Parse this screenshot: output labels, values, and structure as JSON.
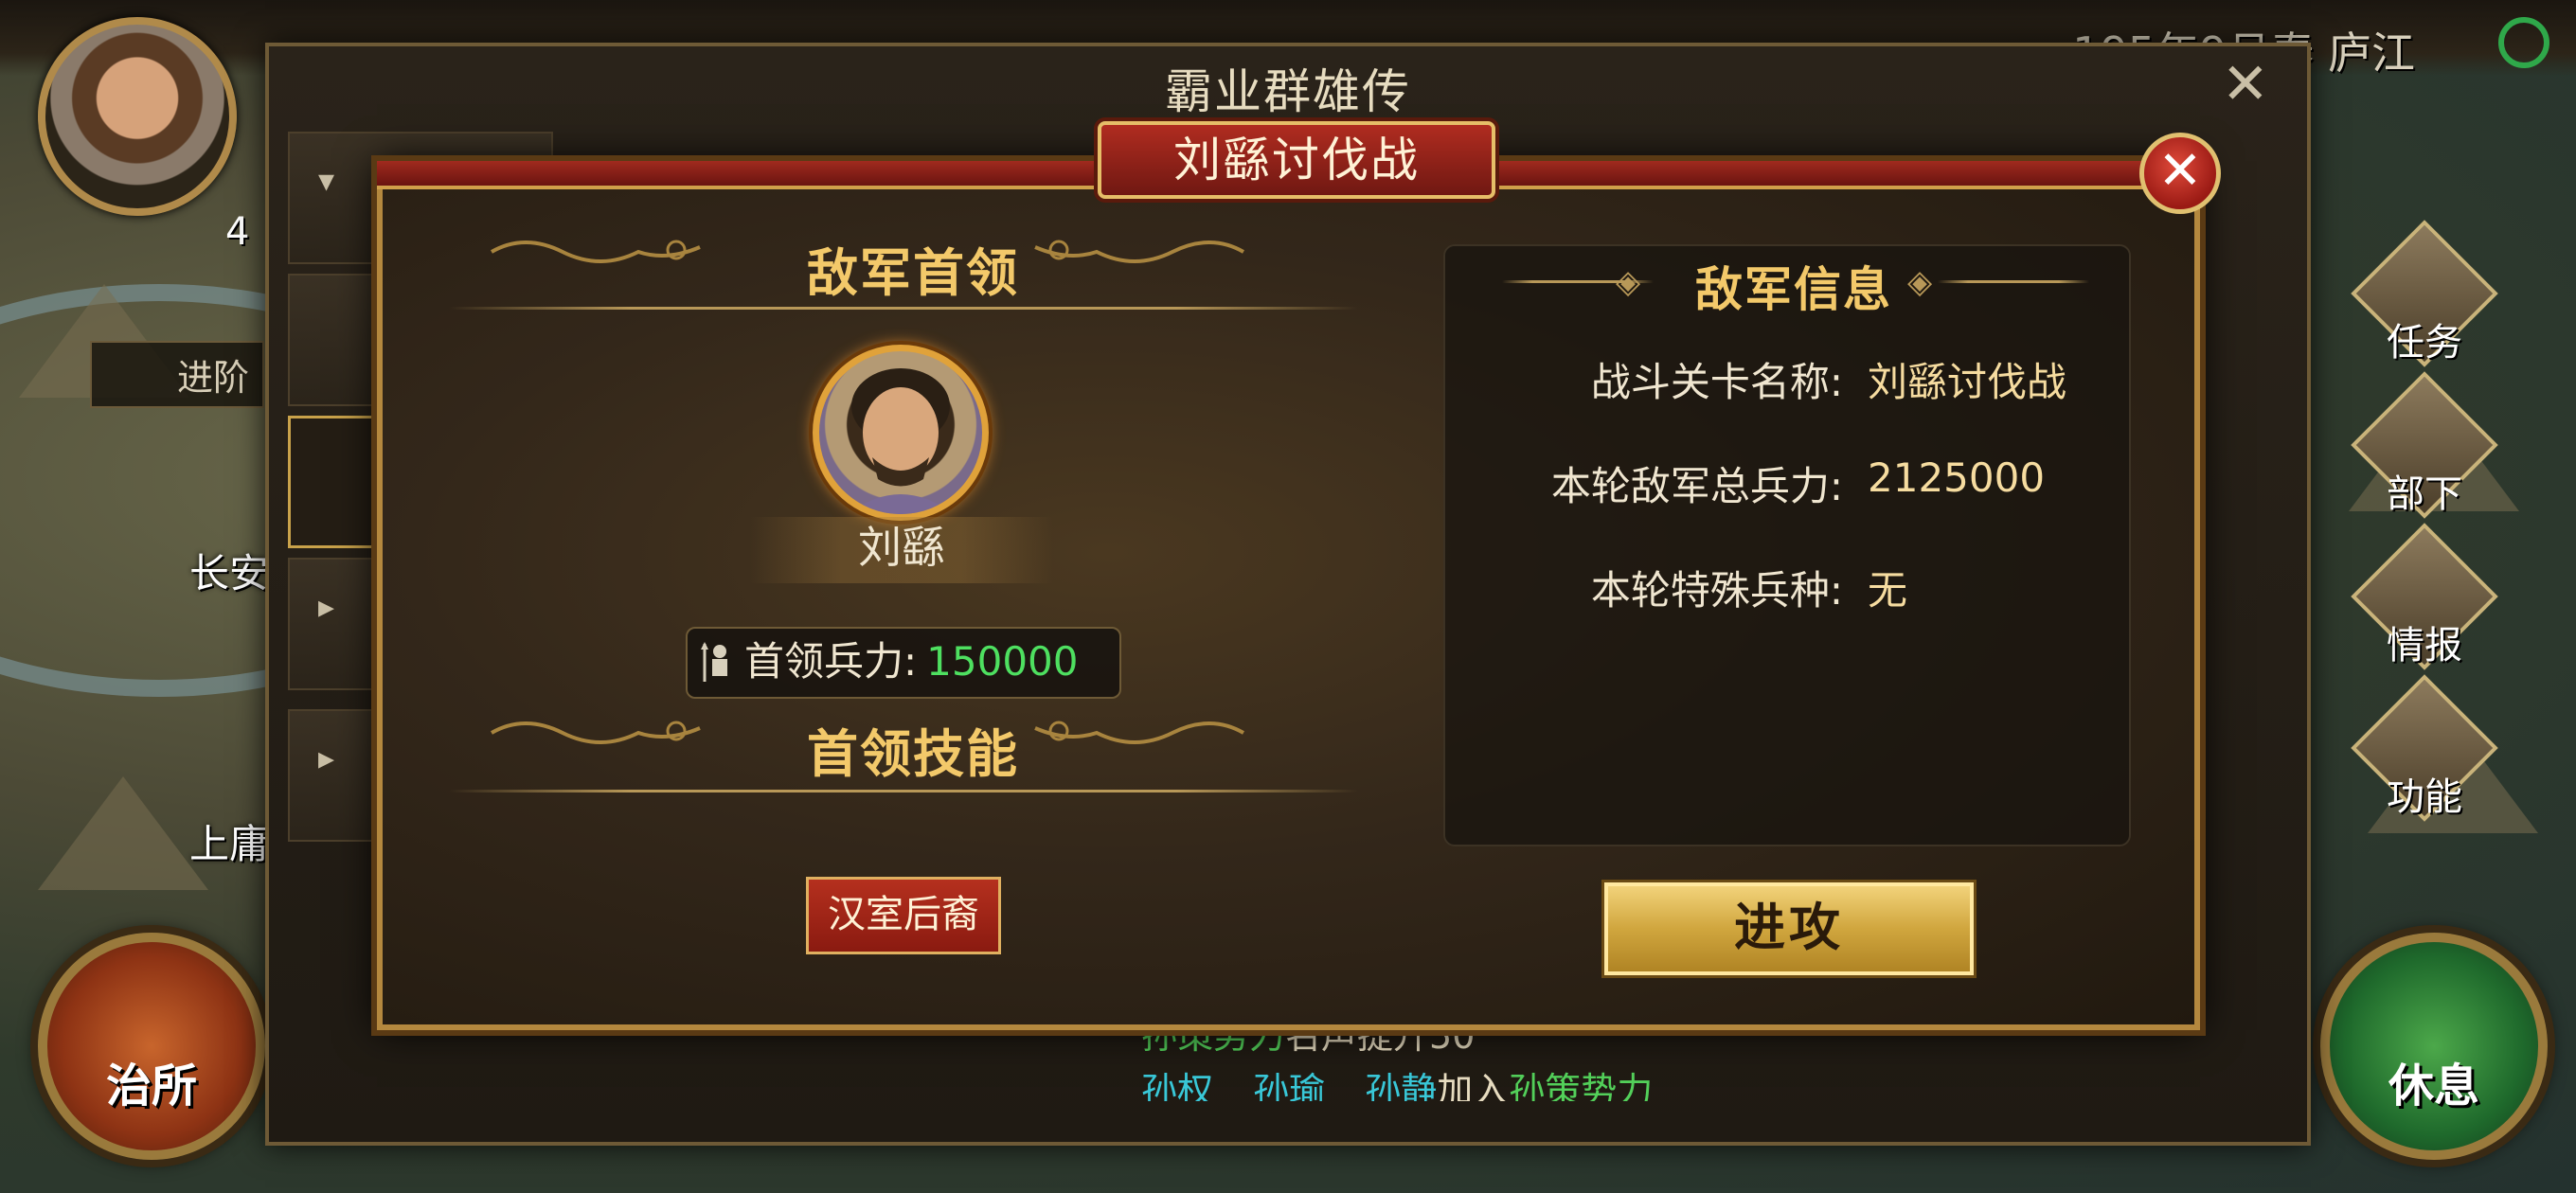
{
  "hud": {
    "date_location": "195年9月春 庐江",
    "left_label": "进阶",
    "map_cities": [
      "长安",
      "上庸"
    ],
    "left_round_button": "治所",
    "right_round_button": "休息",
    "right_menu": [
      "任务",
      "部下",
      "情报",
      "功能"
    ],
    "avatar_level": "4"
  },
  "outer_window": {
    "title": "霸业群雄传",
    "close_glyph": "✕"
  },
  "feed": {
    "line1_faction": "孙策势力",
    "line1_text": "名声提升50",
    "line2_name1": "孙权",
    "line2_name2": "孙瑜",
    "line2_name3": "孙静",
    "line2_text": "加入",
    "line2_faction": "孙策势力"
  },
  "dialog": {
    "title": "刘繇讨伐战",
    "close_glyph": "✕",
    "left": {
      "leader_heading": "敌军首领",
      "leader_name": "刘繇",
      "troops_label": "首领兵力:",
      "troops_value": "150000",
      "skill_heading": "首领技能",
      "skill_button": "汉室后裔"
    },
    "right": {
      "heading": "敌军信息",
      "rows": [
        {
          "key": "战斗关卡名称:",
          "value": "刘繇讨伐战"
        },
        {
          "key": "本轮敌军总兵力:",
          "value": "2125000"
        },
        {
          "key": "本轮特殊兵种:",
          "value": "无"
        }
      ]
    },
    "attack_button": "进攻"
  },
  "colors": {
    "title_red": "#a02a1e",
    "gold": "#f3c96a",
    "troops_green": "#4ee060",
    "feed_green": "#53d05a",
    "feed_cyan": "#39c8d8"
  }
}
